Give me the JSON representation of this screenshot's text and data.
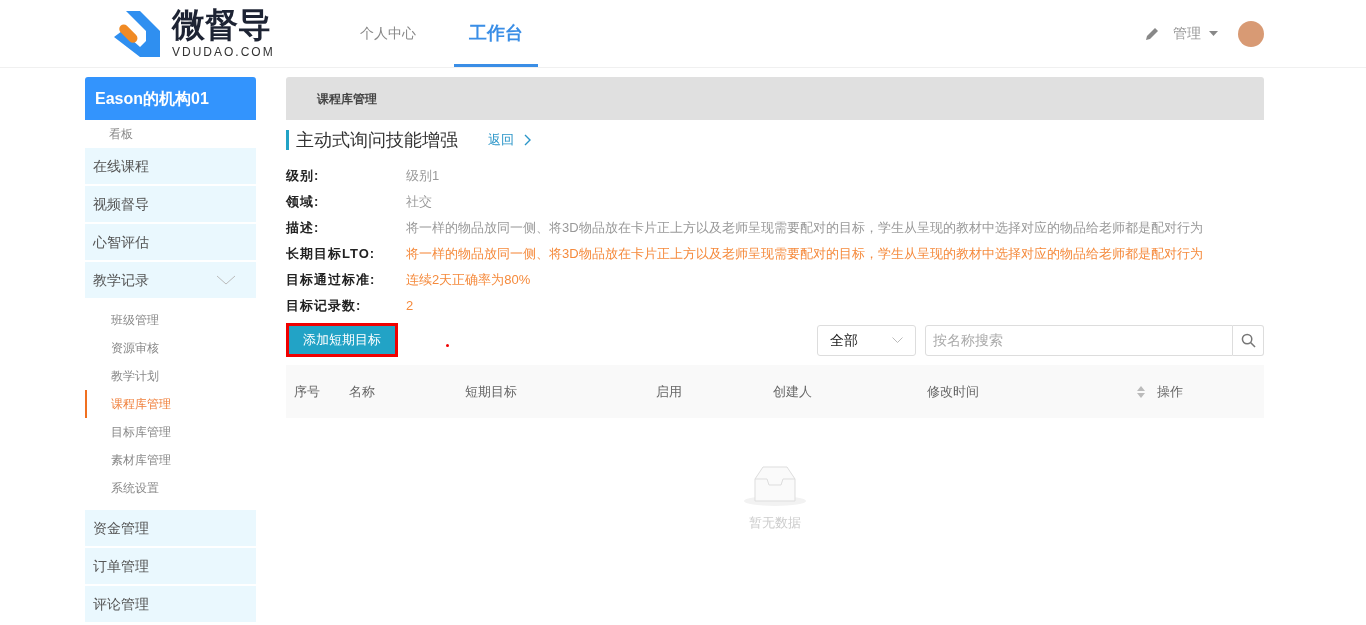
{
  "header": {
    "logo": {
      "name": "微督导",
      "domain": "VDUDAO.COM"
    },
    "nav": [
      {
        "label": "个人中心",
        "selected": false
      },
      {
        "label": "工作台",
        "selected": true
      }
    ],
    "user_menu": {
      "label": "管理"
    }
  },
  "sidebar": {
    "org": "Eason的机构01",
    "items": [
      {
        "label": "看板",
        "kind": "sub",
        "selected": false
      },
      {
        "label": "在线课程",
        "kind": "main"
      },
      {
        "label": "视频督导",
        "kind": "main"
      },
      {
        "label": "心智评估",
        "kind": "main"
      },
      {
        "label": "教学记录",
        "kind": "main",
        "expanded": true,
        "children": [
          {
            "label": "班级管理",
            "selected": false
          },
          {
            "label": "资源审核",
            "selected": false
          },
          {
            "label": "教学计划",
            "selected": false
          },
          {
            "label": "课程库管理",
            "selected": true
          },
          {
            "label": "目标库管理",
            "selected": false
          },
          {
            "label": "素材库管理",
            "selected": false
          },
          {
            "label": "系统设置",
            "selected": false
          }
        ]
      },
      {
        "label": "资金管理",
        "kind": "main"
      },
      {
        "label": "订单管理",
        "kind": "main"
      },
      {
        "label": "评论管理",
        "kind": "main"
      }
    ]
  },
  "breadcrumb": "课程库管理",
  "page_title": "主动式询问技能增强",
  "back_link": "返回",
  "details": [
    {
      "label": "级别:",
      "value": "级别1",
      "kind": "muted"
    },
    {
      "label": "领域:",
      "value": "社交",
      "kind": "muted"
    },
    {
      "label": "描述:",
      "value": "将一样的物品放同一侧、将3D物品放在卡片正上方以及老师呈现需要配对的目标，学生从呈现的教材中选择对应的物品给老师都是配对行为",
      "kind": "muted"
    },
    {
      "label": "长期目标LTO:",
      "value": "将一样的物品放同一侧、将3D物品放在卡片正上方以及老师呈现需要配对的目标，学生从呈现的教材中选择对应的物品给老师都是配对行为",
      "kind": "accent"
    },
    {
      "label": "目标通过标准:",
      "value": "连续2天正确率为80%",
      "kind": "accent"
    },
    {
      "label": "目标记录数:",
      "value": "2",
      "kind": "accent"
    }
  ],
  "add_button": {
    "label": "添加短期目标",
    "highlighted": true
  },
  "filter": {
    "value": "全部"
  },
  "search": {
    "placeholder": "按名称搜索"
  },
  "table": {
    "columns": [
      {
        "label": "序号",
        "sortable": false
      },
      {
        "label": "名称",
        "sortable": false
      },
      {
        "label": "短期目标",
        "sortable": false
      },
      {
        "label": "启用",
        "sortable": false
      },
      {
        "label": "创建人",
        "sortable": false
      },
      {
        "label": "修改时间",
        "sortable": true
      },
      {
        "label": "操作",
        "sortable": false
      }
    ],
    "empty_text": "暂无数据"
  }
}
